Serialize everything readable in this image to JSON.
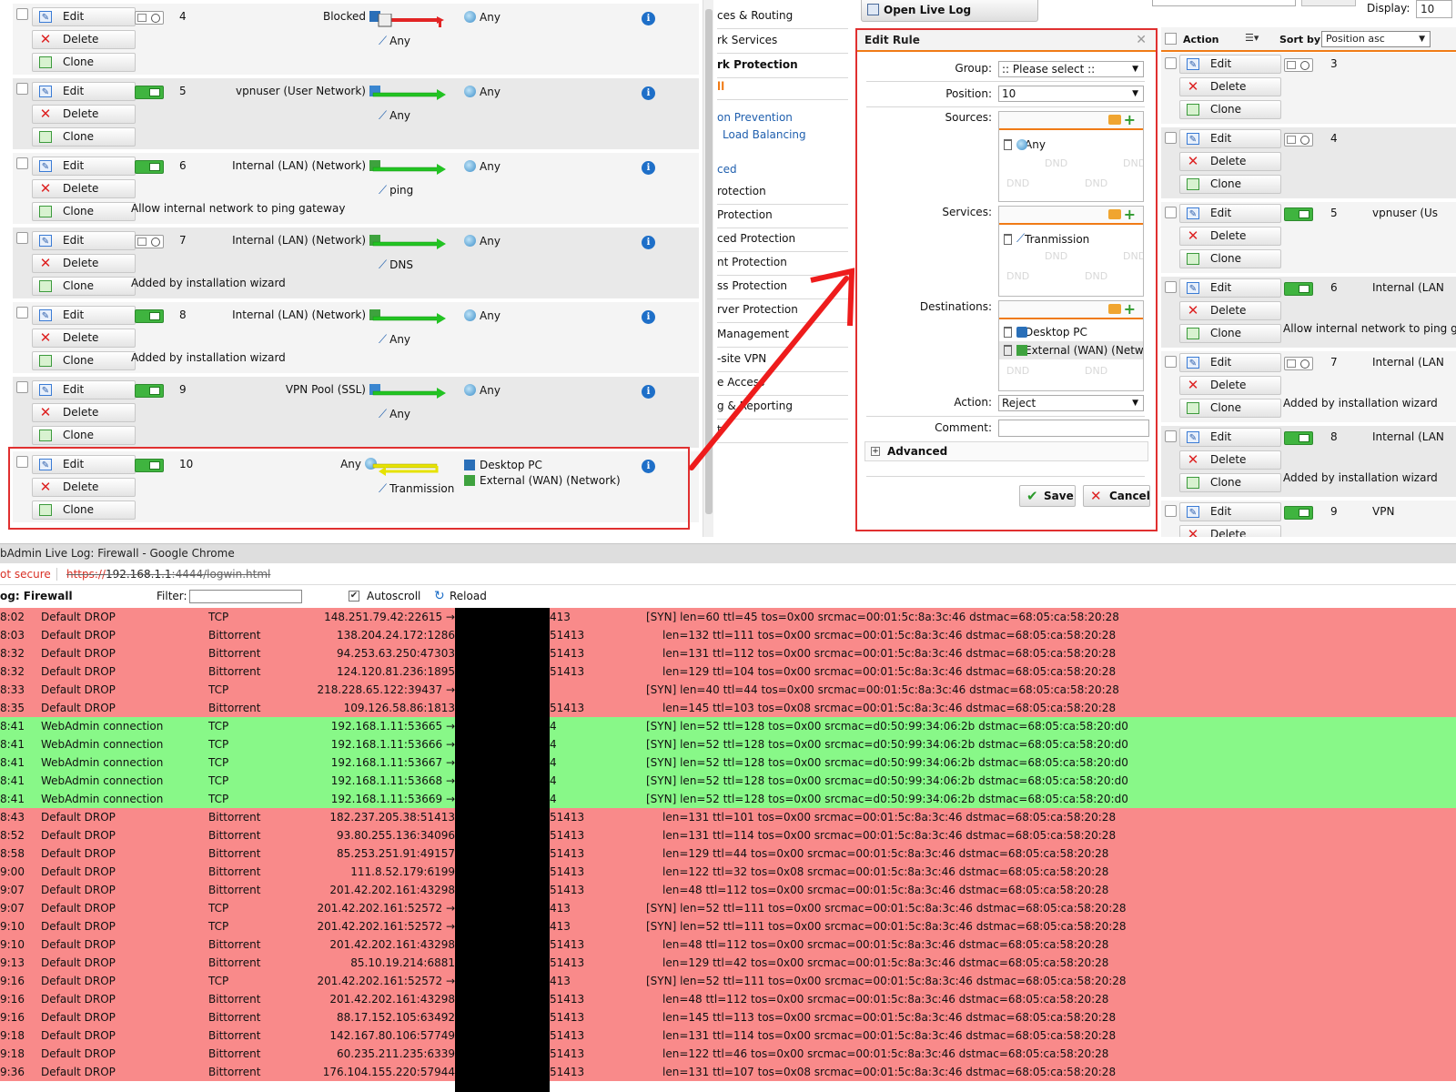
{
  "rules": [
    {
      "num": "4",
      "enabled": false,
      "source": "Blocked",
      "source_icon": "host-icon",
      "flow": "red",
      "service": "Any",
      "destinations": [
        "Any"
      ],
      "comment": ""
    },
    {
      "num": "5",
      "enabled": true,
      "source": "vpnuser (User Network)",
      "source_icon": "user-network-icon",
      "flow": "green",
      "service": "Any",
      "destinations": [
        "Any"
      ],
      "comment": ""
    },
    {
      "num": "6",
      "enabled": true,
      "source": "Internal (LAN) (Network)",
      "source_icon": "network-icon",
      "flow": "green",
      "service": "ping",
      "destinations": [
        "Any"
      ],
      "comment": "Allow internal network to ping gateway"
    },
    {
      "num": "7",
      "enabled": false,
      "source": "Internal (LAN) (Network)",
      "source_icon": "network-icon",
      "flow": "green",
      "service": "DNS",
      "destinations": [
        "Any"
      ],
      "comment": "Added by installation wizard"
    },
    {
      "num": "8",
      "enabled": true,
      "source": "Internal (LAN) (Network)",
      "source_icon": "network-icon",
      "flow": "green",
      "service": "Any",
      "destinations": [
        "Any"
      ],
      "comment": "Added by installation wizard"
    },
    {
      "num": "9",
      "enabled": true,
      "source": "VPN Pool (SSL)",
      "source_icon": "vpn-pool-icon",
      "flow": "green",
      "service": "Any",
      "destinations": [
        "Any"
      ],
      "comment": ""
    },
    {
      "num": "10",
      "enabled": true,
      "source": "Any",
      "source_icon": "globe-icon",
      "flow": "yellow",
      "service": "Tranmission",
      "destinations": [
        "Desktop PC",
        "External (WAN) (Network)"
      ],
      "comment": ""
    }
  ],
  "actions": {
    "edit": "Edit",
    "delete": "Delete",
    "clone": "Clone"
  },
  "nav": {
    "items": [
      "ces & Routing",
      "rk Services",
      "rk Protection",
      "ll",
      "on Prevention",
      "Load Balancing",
      "ced",
      "rotection",
      "Protection",
      "ced Protection",
      "nt Protection",
      "ss Protection",
      "rver Protection",
      "Management",
      "-site VPN",
      "e Access",
      "g & Reporting",
      "t"
    ]
  },
  "toolbar": {
    "open_live_log": "Open Live Log",
    "display_label": "Display:",
    "display_value": "10"
  },
  "dialog": {
    "title": "Edit Rule",
    "group_label": "Group:",
    "group_value": ":: Please select ::",
    "position_label": "Position:",
    "position_value": "10",
    "sources_label": "Sources:",
    "sources": [
      "Any"
    ],
    "services_label": "Services:",
    "services": [
      "Tranmission"
    ],
    "destinations_label": "Destinations:",
    "destinations": [
      "Desktop PC",
      "External (WAN) (Netw"
    ],
    "action_label": "Action:",
    "action_value": "Reject",
    "comment_label": "Comment:",
    "advanced_label": "Advanced",
    "dnd": "DND",
    "save": "Save",
    "cancel": "Cancel"
  },
  "right": {
    "action_header": "Action",
    "sort_label": "Sort by:",
    "sort_value": "Position asc",
    "rows": [
      {
        "num": "3",
        "enabled": false,
        "source": "",
        "comment": ""
      },
      {
        "num": "4",
        "enabled": false,
        "source": "",
        "comment": ""
      },
      {
        "num": "5",
        "enabled": true,
        "source": "vpnuser (Us",
        "comment": ""
      },
      {
        "num": "6",
        "enabled": true,
        "source": "Internal (LAN",
        "comment": "Allow internal network to ping gate"
      },
      {
        "num": "7",
        "enabled": false,
        "source": "Internal (LAN",
        "comment": "Added by installation wizard"
      },
      {
        "num": "8",
        "enabled": true,
        "source": "Internal (LAN",
        "comment": "Added by installation wizard"
      },
      {
        "num": "9",
        "enabled": true,
        "source": "VPN",
        "comment": ""
      }
    ]
  },
  "log": {
    "window_title": "bAdmin Live Log: Firewall - Google Chrome",
    "not_secure": "ot secure",
    "url_scheme": "https://",
    "url_host": "192.168.1.1",
    "url_rest": ":4444/logwin.html",
    "heading": "og: Firewall",
    "filter_label": "Filter:",
    "autoscroll_label": "Autoscroll",
    "reload_label": "Reload",
    "lines": [
      {
        "type": "drop",
        "time": "8:02",
        "action": "Default DROP",
        "proto": "TCP",
        "src": "148.251.79.42:22615 →",
        "port": "413",
        "details": "[SYN]  len=60  ttl=45  tos=0x00  srcmac=00:01:5c:8a:3c:46  dstmac=68:05:ca:58:20:28"
      },
      {
        "type": "drop",
        "time": "8:03",
        "action": "Default DROP",
        "proto": "Bittorrent",
        "src": "138.204.24.172:1286",
        "port": "51413",
        "details": "len=132  ttl=111  tos=0x00  srcmac=00:01:5c:8a:3c:46  dstmac=68:05:ca:58:20:28"
      },
      {
        "type": "drop",
        "time": "8:32",
        "action": "Default DROP",
        "proto": "Bittorrent",
        "src": "94.253.63.250:47303",
        "port": "51413",
        "details": "len=131  ttl=112  tos=0x00  srcmac=00:01:5c:8a:3c:46  dstmac=68:05:ca:58:20:28"
      },
      {
        "type": "drop",
        "time": "8:32",
        "action": "Default DROP",
        "proto": "Bittorrent",
        "src": "124.120.81.236:1895",
        "port": "51413",
        "details": "len=129  ttl=104  tos=0x00  srcmac=00:01:5c:8a:3c:46  dstmac=68:05:ca:58:20:28"
      },
      {
        "type": "drop",
        "time": "8:33",
        "action": "Default DROP",
        "proto": "TCP",
        "src": "218.228.65.122:39437 →",
        "port": "",
        "details": "[SYN]  len=40  ttl=44  tos=0x00  srcmac=00:01:5c:8a:3c:46  dstmac=68:05:ca:58:20:28"
      },
      {
        "type": "drop",
        "time": "8:35",
        "action": "Default DROP",
        "proto": "Bittorrent",
        "src": "109.126.58.86:1813",
        "port": "51413",
        "details": "len=145  ttl=103  tos=0x08  srcmac=00:01:5c:8a:3c:46  dstmac=68:05:ca:58:20:28"
      },
      {
        "type": "allow",
        "time": "8:41",
        "action": "WebAdmin connection",
        "proto": "TCP",
        "src": "192.168.1.11:53665 →",
        "port": "4",
        "details": "[SYN]  len=52  ttl=128  tos=0x00  srcmac=d0:50:99:34:06:2b  dstmac=68:05:ca:58:20:d0"
      },
      {
        "type": "allow",
        "time": "8:41",
        "action": "WebAdmin connection",
        "proto": "TCP",
        "src": "192.168.1.11:53666 →",
        "port": "4",
        "details": "[SYN]  len=52  ttl=128  tos=0x00  srcmac=d0:50:99:34:06:2b  dstmac=68:05:ca:58:20:d0"
      },
      {
        "type": "allow",
        "time": "8:41",
        "action": "WebAdmin connection",
        "proto": "TCP",
        "src": "192.168.1.11:53667 →",
        "port": "4",
        "details": "[SYN]  len=52  ttl=128  tos=0x00  srcmac=d0:50:99:34:06:2b  dstmac=68:05:ca:58:20:d0"
      },
      {
        "type": "allow",
        "time": "8:41",
        "action": "WebAdmin connection",
        "proto": "TCP",
        "src": "192.168.1.11:53668 →",
        "port": "4",
        "details": "[SYN]  len=52  ttl=128  tos=0x00  srcmac=d0:50:99:34:06:2b  dstmac=68:05:ca:58:20:d0"
      },
      {
        "type": "allow",
        "time": "8:41",
        "action": "WebAdmin connection",
        "proto": "TCP",
        "src": "192.168.1.11:53669 →",
        "port": "4",
        "details": "[SYN]  len=52  ttl=128  tos=0x00  srcmac=d0:50:99:34:06:2b  dstmac=68:05:ca:58:20:d0"
      },
      {
        "type": "drop",
        "time": "8:43",
        "action": "Default DROP",
        "proto": "Bittorrent",
        "src": "182.237.205.38:51413",
        "port": "51413",
        "details": "len=131  ttl=101  tos=0x00  srcmac=00:01:5c:8a:3c:46  dstmac=68:05:ca:58:20:28"
      },
      {
        "type": "drop",
        "time": "8:52",
        "action": "Default DROP",
        "proto": "Bittorrent",
        "src": "93.80.255.136:34096",
        "port": "51413",
        "details": "len=131  ttl=114  tos=0x00  srcmac=00:01:5c:8a:3c:46  dstmac=68:05:ca:58:20:28"
      },
      {
        "type": "drop",
        "time": "8:58",
        "action": "Default DROP",
        "proto": "Bittorrent",
        "src": "85.253.251.91:49157",
        "port": "51413",
        "details": "len=129  ttl=44  tos=0x00  srcmac=00:01:5c:8a:3c:46  dstmac=68:05:ca:58:20:28"
      },
      {
        "type": "drop",
        "time": "9:00",
        "action": "Default DROP",
        "proto": "Bittorrent",
        "src": "111.8.52.179:6199",
        "port": "51413",
        "details": "len=122  ttl=32  tos=0x08  srcmac=00:01:5c:8a:3c:46  dstmac=68:05:ca:58:20:28"
      },
      {
        "type": "drop",
        "time": "9:07",
        "action": "Default DROP",
        "proto": "Bittorrent",
        "src": "201.42.202.161:43298",
        "port": "51413",
        "details": "len=48  ttl=112  tos=0x00  srcmac=00:01:5c:8a:3c:46  dstmac=68:05:ca:58:20:28"
      },
      {
        "type": "drop",
        "time": "9:07",
        "action": "Default DROP",
        "proto": "TCP",
        "src": "201.42.202.161:52572 →",
        "port": "413",
        "details": "[SYN]  len=52  ttl=111  tos=0x00  srcmac=00:01:5c:8a:3c:46  dstmac=68:05:ca:58:20:28"
      },
      {
        "type": "drop",
        "time": "9:10",
        "action": "Default DROP",
        "proto": "TCP",
        "src": "201.42.202.161:52572 →",
        "port": "413",
        "details": "[SYN]  len=52  ttl=111  tos=0x00  srcmac=00:01:5c:8a:3c:46  dstmac=68:05:ca:58:20:28"
      },
      {
        "type": "drop",
        "time": "9:10",
        "action": "Default DROP",
        "proto": "Bittorrent",
        "src": "201.42.202.161:43298",
        "port": "51413",
        "details": "len=48  ttl=112  tos=0x00  srcmac=00:01:5c:8a:3c:46  dstmac=68:05:ca:58:20:28"
      },
      {
        "type": "drop",
        "time": "9:13",
        "action": "Default DROP",
        "proto": "Bittorrent",
        "src": "85.10.19.214:6881",
        "port": "51413",
        "details": "len=129  ttl=42  tos=0x00  srcmac=00:01:5c:8a:3c:46  dstmac=68:05:ca:58:20:28"
      },
      {
        "type": "drop",
        "time": "9:16",
        "action": "Default DROP",
        "proto": "TCP",
        "src": "201.42.202.161:52572 →",
        "port": "413",
        "details": "[SYN]  len=52  ttl=111  tos=0x00  srcmac=00:01:5c:8a:3c:46  dstmac=68:05:ca:58:20:28"
      },
      {
        "type": "drop",
        "time": "9:16",
        "action": "Default DROP",
        "proto": "Bittorrent",
        "src": "201.42.202.161:43298",
        "port": "51413",
        "details": "len=48  ttl=112  tos=0x00  srcmac=00:01:5c:8a:3c:46  dstmac=68:05:ca:58:20:28"
      },
      {
        "type": "drop",
        "time": "9:16",
        "action": "Default DROP",
        "proto": "Bittorrent",
        "src": "88.17.152.105:63492",
        "port": "51413",
        "details": "len=145  ttl=113  tos=0x00  srcmac=00:01:5c:8a:3c:46  dstmac=68:05:ca:58:20:28"
      },
      {
        "type": "drop",
        "time": "9:18",
        "action": "Default DROP",
        "proto": "Bittorrent",
        "src": "142.167.80.106:57749",
        "port": "51413",
        "details": "len=131  ttl=114  tos=0x00  srcmac=00:01:5c:8a:3c:46  dstmac=68:05:ca:58:20:28"
      },
      {
        "type": "drop",
        "time": "9:18",
        "action": "Default DROP",
        "proto": "Bittorrent",
        "src": "60.235.211.235:6339",
        "port": "51413",
        "details": "len=122  ttl=46  tos=0x00  srcmac=00:01:5c:8a:3c:46  dstmac=68:05:ca:58:20:28"
      },
      {
        "type": "drop",
        "time": "9:36",
        "action": "Default DROP",
        "proto": "Bittorrent",
        "src": "176.104.155.220:57944",
        "port": "51413",
        "details": "len=131  ttl=107  tos=0x08  srcmac=00:01:5c:8a:3c:46  dstmac=68:05:ca:58:20:28"
      }
    ]
  },
  "colors": {
    "accent": "#f07b16",
    "highlight": "#e03030",
    "drop_row": "#f98a8a",
    "allow_row": "#88f888",
    "toggle_on": "#3fb43f",
    "link": "#1f5fae"
  }
}
